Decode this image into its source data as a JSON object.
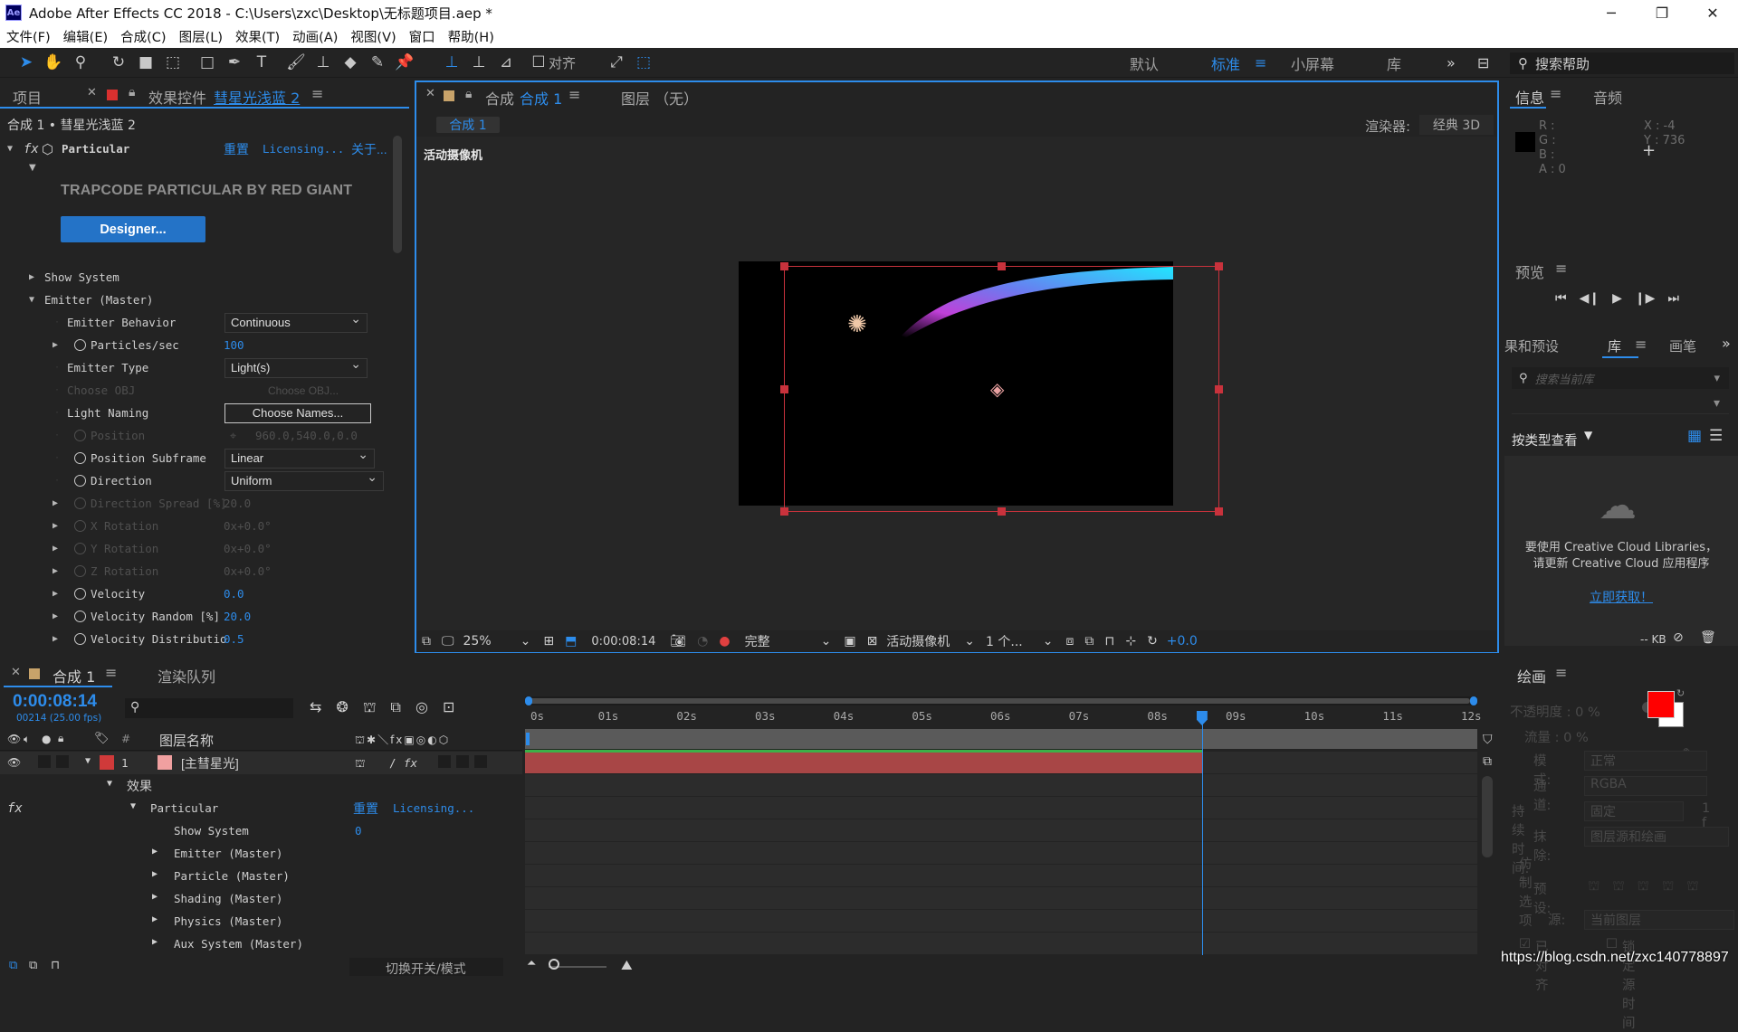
{
  "app": {
    "title": "Adobe After Effects CC 2018 - C:\\Users\\zxc\\Desktop\\无标题项目.aep *",
    "logo": "Ae"
  },
  "menu": [
    "文件(F)",
    "编辑(E)",
    "合成(C)",
    "图层(L)",
    "效果(T)",
    "动画(A)",
    "视图(V)",
    "窗口",
    "帮助(H)"
  ],
  "toolbar": {
    "snap_label": "对齐",
    "workspaces": [
      "默认",
      "标准",
      "小屏幕",
      "库"
    ],
    "active_workspace": "标准",
    "search_placeholder": "搜索帮助"
  },
  "project_panel": {
    "tab_project": "项目",
    "tab_effects": "效果控件",
    "effects_layer": "彗星光浅蓝 2",
    "breadcrumb": "合成 1 • 彗星光浅蓝 2"
  },
  "effect": {
    "name": "Particular",
    "reset": "重置",
    "licensing": "Licensing...",
    "about": "关于...",
    "banner": "TRAPCODE PARTICULAR BY RED GIANT",
    "designer_btn": "Designer..."
  },
  "effect_rows": [
    {
      "label": "Show System",
      "arrow": "right",
      "indent": 0
    },
    {
      "label": "Emitter (Master)",
      "arrow": "down",
      "indent": 0
    },
    {
      "label": "Emitter Behavior",
      "indent": 1,
      "dropdown": "Continuous"
    },
    {
      "label": "Particles/sec",
      "arrow": "right",
      "indent": 1,
      "stopwatch": true,
      "value": "100"
    },
    {
      "label": "Emitter Type",
      "indent": 1,
      "dropdown": "Light(s)"
    },
    {
      "label": "Choose OBJ",
      "indent": 1,
      "dim": true,
      "dimval": "Choose OBJ..."
    },
    {
      "label": "Light Naming",
      "indent": 1,
      "button": "Choose Names..."
    },
    {
      "label": "Position",
      "indent": 1,
      "stopwatch": true,
      "dim": true,
      "value": "960.0,540.0,0.0"
    },
    {
      "label": "Position Subframe",
      "indent": 1,
      "stopwatch": true,
      "dropdown": "Linear"
    },
    {
      "label": "Direction",
      "indent": 1,
      "stopwatch": true,
      "dropdown": "Uniform"
    },
    {
      "label": "Direction Spread [%]",
      "arrow": "right",
      "indent": 1,
      "stopwatch": true,
      "dim": true,
      "value": "20.0"
    },
    {
      "label": "X Rotation",
      "arrow": "right",
      "indent": 1,
      "stopwatch": true,
      "dim": true,
      "value": "0x+0.0°"
    },
    {
      "label": "Y Rotation",
      "arrow": "right",
      "indent": 1,
      "stopwatch": true,
      "dim": true,
      "value": "0x+0.0°"
    },
    {
      "label": "Z Rotation",
      "arrow": "right",
      "indent": 1,
      "stopwatch": true,
      "dim": true,
      "value": "0x+0.0°"
    },
    {
      "label": "Velocity",
      "arrow": "right",
      "indent": 1,
      "stopwatch": true,
      "value": "0.0"
    },
    {
      "label": "Velocity Random [%]",
      "arrow": "right",
      "indent": 1,
      "stopwatch": true,
      "value": "20.0"
    },
    {
      "label": "Velocity Distributio",
      "arrow": "right",
      "indent": 1,
      "stopwatch": true,
      "value": "0.5"
    }
  ],
  "viewer": {
    "tab_comp": "合成",
    "comp_name": "合成 1",
    "tab_layer": "图层 （无）",
    "sub_tab": "合成 1",
    "renderer_label": "渲染器:",
    "renderer": "经典 3D",
    "camera_label": "活动摄像机"
  },
  "viewer_bar": {
    "zoom": "25%",
    "timecode": "0:00:08:14",
    "quality": "完整",
    "camera": "活动摄像机",
    "views": "1 个...",
    "exposure": "+0.0"
  },
  "info": {
    "tab_info": "信息",
    "tab_audio": "音频",
    "r": "R :",
    "g": "G :",
    "b": "B :",
    "a": "A : 0",
    "x": "X : -4",
    "y": "Y : 736"
  },
  "preview": {
    "title": "预览"
  },
  "libraries": {
    "tab_effects": "果和预设",
    "tab_lib": "库",
    "tab_paint": "画笔",
    "search_placeholder": "搜索当前库",
    "view_by": "按类型查看",
    "msg1": "要使用 Creative Cloud Libraries，",
    "msg2": "请更新 Creative Cloud 应用程序",
    "link": "立即获取！",
    "kb": "-- KB"
  },
  "timeline": {
    "tab_comp": "合成 1",
    "tab_render": "渲染队列",
    "timecode": "0:00:08:14",
    "fps": "00214 (25.00 fps)",
    "search_placeholder": "",
    "col_layer": "图层名称",
    "col_num": "#",
    "layer_num": "1",
    "layer_name": "[主彗星光]",
    "effects_label": "效果",
    "particular": "Particular",
    "reset": "重置",
    "licensing": "Licensing...",
    "show_system": "Show System",
    "show_val": "0",
    "groups": [
      "Emitter (Master)",
      "Particle (Master)",
      "Shading (Master)",
      "Physics (Master)",
      "Aux System (Master)"
    ],
    "switch_mode": "切换开关/模式",
    "ruler": [
      "0s",
      "01s",
      "02s",
      "03s",
      "04s",
      "05s",
      "06s",
      "07s",
      "08s",
      "09s",
      "10s",
      "11s",
      "12s"
    ],
    "playhead_seconds": 8.56,
    "duration_seconds": 12
  },
  "paint": {
    "title": "绘画",
    "opacity": "不透明度 : 0 %",
    "flow": "流量 : 0 %",
    "mode_label": "模式:",
    "mode": "正常",
    "channel_label": "通道:",
    "channel": "RGBA",
    "duration_label": "持续时间:",
    "duration": "固定",
    "duration_val": "1 f",
    "erase_label": "抹除:",
    "erase": "图层源和绘画",
    "clone_label": "仿制选项",
    "preset_label": "预设:",
    "source_label": "源:",
    "source": "当前图层",
    "aligned": "已对齐",
    "lock_time": "锁定源时间",
    "fg_color": "#ff0000",
    "bg_color": "#ffffff"
  },
  "watermark": "https://blog.csdn.net/zxc140778897"
}
